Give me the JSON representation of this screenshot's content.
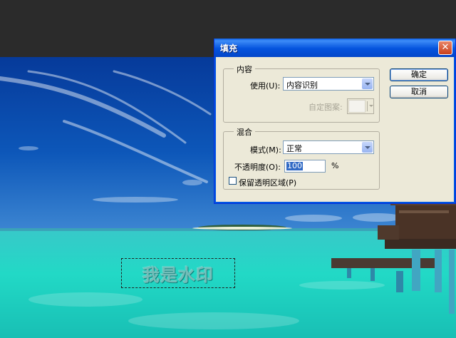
{
  "dialog": {
    "title": "填充",
    "close_icon": "close-icon",
    "ok_label": "确定",
    "cancel_label": "取消",
    "content_group": {
      "legend": "内容",
      "use_label": "使用(U):",
      "use_value": "内容识别",
      "pattern_label": "自定图案:"
    },
    "blend_group": {
      "legend": "混合",
      "mode_label": "模式(M):",
      "mode_value": "正常",
      "opacity_label": "不透明度(O):",
      "opacity_value": "100",
      "opacity_unit": "%",
      "preserve_label": "保留透明区域(P)",
      "preserve_checked": false
    }
  },
  "canvas": {
    "watermark_text": "我是水印"
  },
  "colors": {
    "titlebar": "#0453dd",
    "dialog_bg": "#ece9d8",
    "sky": "#0b4fae",
    "sea": "#2fd5c5"
  }
}
